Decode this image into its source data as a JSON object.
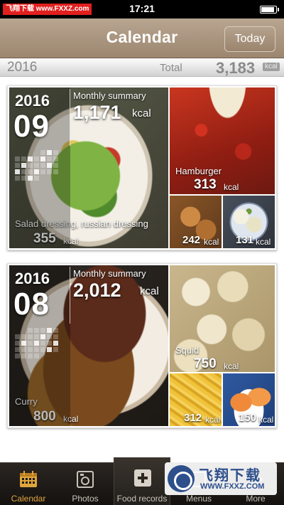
{
  "status_bar": {
    "time": "17:21",
    "watermark": "飞翔下载 www.FXXZ.com"
  },
  "nav": {
    "title": "Calendar",
    "today_label": "Today"
  },
  "total_bar": {
    "year": "2016",
    "label": "Total",
    "value": "3,183",
    "unit": "kcal"
  },
  "months": [
    {
      "year": "2016",
      "month": "09",
      "summary_label": "Monthly summary",
      "summary_value": "1,171",
      "summary_unit": "kcal",
      "main_food": {
        "name": "Salad dressing, russian dressing",
        "kcal": "355",
        "unit": "kcal"
      },
      "top_right": {
        "name": "Hamburger",
        "kcal": "313",
        "unit": "kcal"
      },
      "bottom_left": {
        "kcal": "242",
        "unit": "kcal"
      },
      "bottom_right": {
        "kcal": "131",
        "unit": "kcal"
      }
    },
    {
      "year": "2016",
      "month": "08",
      "summary_label": "Monthly summary",
      "summary_value": "2,012",
      "summary_unit": "kcal",
      "main_food": {
        "name": "Curry",
        "kcal": "800",
        "unit": "kcal"
      },
      "top_right": {
        "name": "Squid",
        "kcal": "750",
        "unit": "kcal"
      },
      "bottom_left": {
        "kcal": "312",
        "unit": "kcal"
      },
      "bottom_right": {
        "kcal": "150",
        "unit": "kcal"
      }
    }
  ],
  "tabs": [
    {
      "label": "Calendar",
      "icon": "calendar-icon",
      "active": true
    },
    {
      "label": "Photos",
      "icon": "photos-icon",
      "active": false
    },
    {
      "label": "Food records",
      "icon": "plus-icon",
      "active": false
    },
    {
      "label": "Menus",
      "icon": "menus-icon",
      "active": false
    },
    {
      "label": "More",
      "icon": "more-icon",
      "active": false
    }
  ],
  "watermark_bottom": {
    "text": "飞翔下载",
    "url": "WWW.FXXZ.COM"
  },
  "colors": {
    "nav_bg": "#a8927c",
    "tab_active": "#e0a63c",
    "tab_bar_bg": "#1d1a17"
  }
}
